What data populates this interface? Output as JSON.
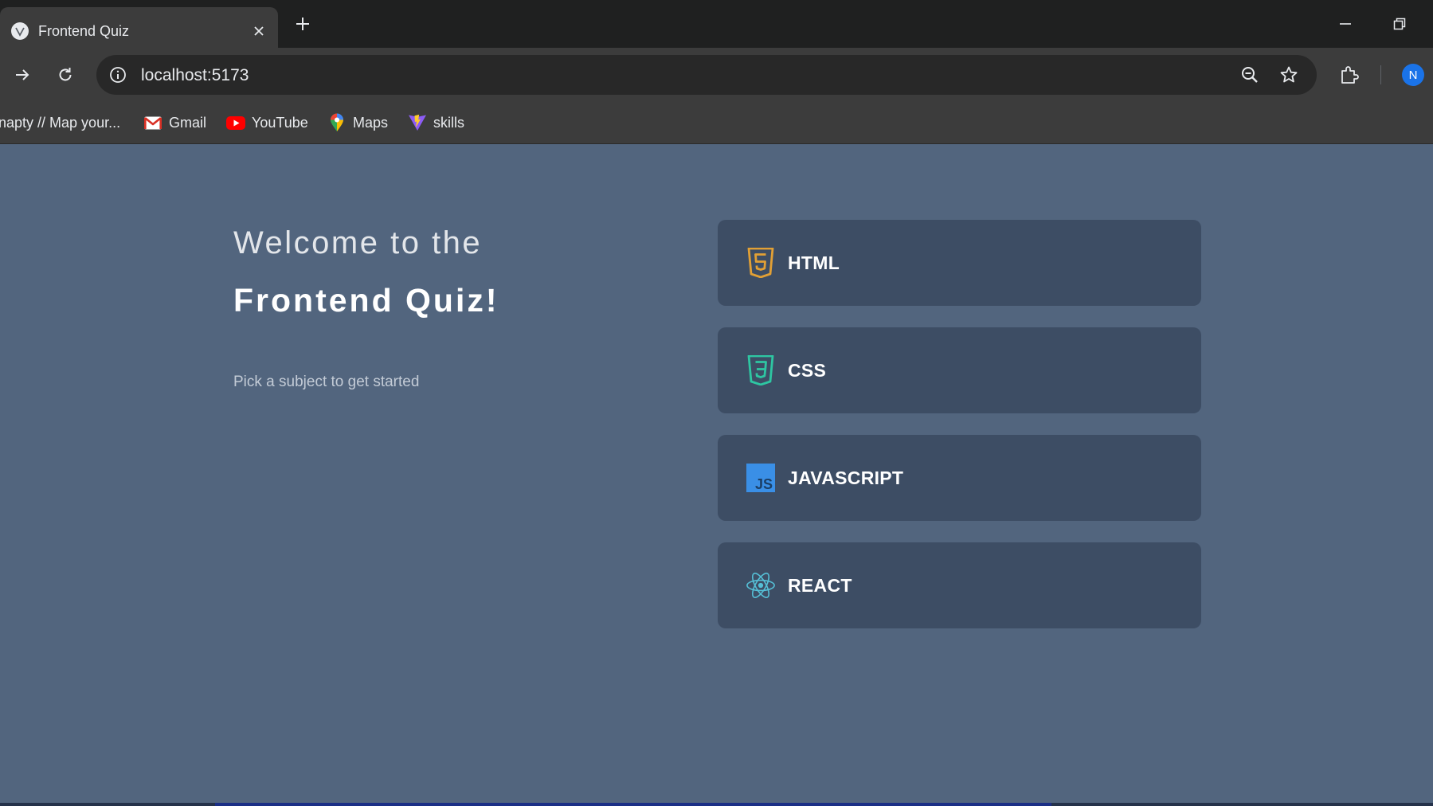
{
  "browser": {
    "tab": {
      "title": "Frontend Quiz",
      "favicon": "vite-favicon-icon"
    },
    "address_bar": {
      "url": "localhost:5173"
    },
    "profile_initial": "N",
    "bookmarks": [
      {
        "label": "napty // Map your...",
        "icon": "bookmark-icon"
      },
      {
        "label": "Gmail",
        "icon": "gmail-icon"
      },
      {
        "label": "YouTube",
        "icon": "youtube-icon"
      },
      {
        "label": "Maps",
        "icon": "maps-icon"
      },
      {
        "label": "skills",
        "icon": "vite-icon"
      }
    ]
  },
  "main": {
    "welcome_line1": "Welcome to the",
    "welcome_line2": "Frontend Quiz!",
    "subtitle": "Pick a subject to get started",
    "subjects": [
      {
        "label": "HTML",
        "icon": "html5-icon",
        "color": "#e2a035"
      },
      {
        "label": "CSS",
        "icon": "css3-icon",
        "color": "#2ec6a2"
      },
      {
        "label": "JAVASCRIPT",
        "icon": "javascript-icon",
        "color": "#3a8fe6"
      },
      {
        "label": "REACT",
        "icon": "react-icon",
        "color": "#55bfd6"
      }
    ]
  },
  "colors": {
    "page_background": "#52657e",
    "card_background": "#3d4d64",
    "browser_frame": "#3c3c3c",
    "accent_blue": "#1a73e8"
  }
}
